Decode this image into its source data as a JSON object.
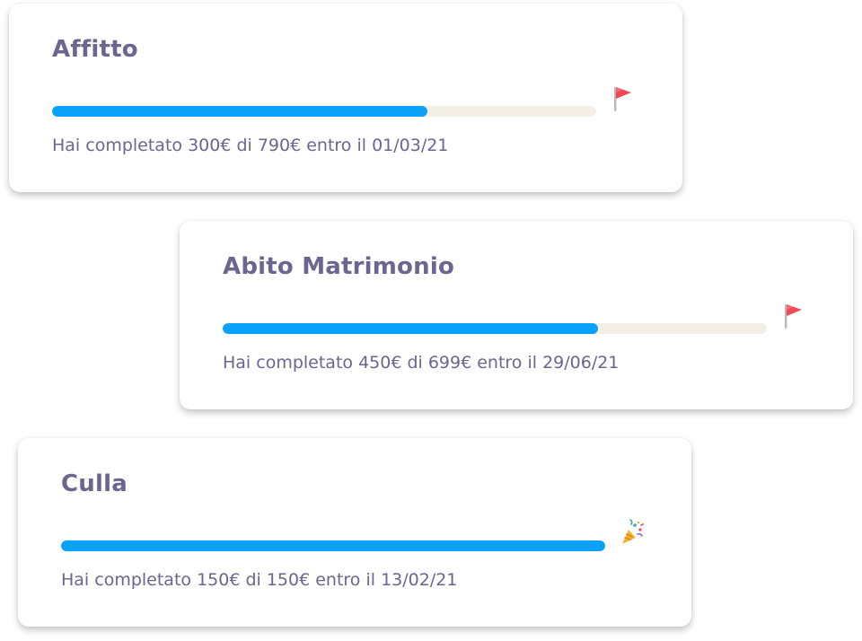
{
  "goals": [
    {
      "title": "Affitto",
      "progress": 0.69,
      "status_text": "Hai completato 300€ di 790€ entro il 01/03/21",
      "status_icon": "flag-icon",
      "accent_color": "#0aa1fb",
      "track_color": "#f3efe7"
    },
    {
      "title": "Abito Matrimonio",
      "progress": 0.69,
      "status_text": "Hai completato 450€ di 699€ entro il 29/06/21",
      "status_icon": "flag-icon",
      "accent_color": "#0aa1fb",
      "track_color": "#f3efe7"
    },
    {
      "title": "Culla",
      "progress": 1.0,
      "status_text": "Hai completato 150€ di 150€ entro il 13/02/21",
      "status_icon": "party-popper-icon",
      "accent_color": "#0aa1fb",
      "track_color": "#f3efe7"
    }
  ]
}
